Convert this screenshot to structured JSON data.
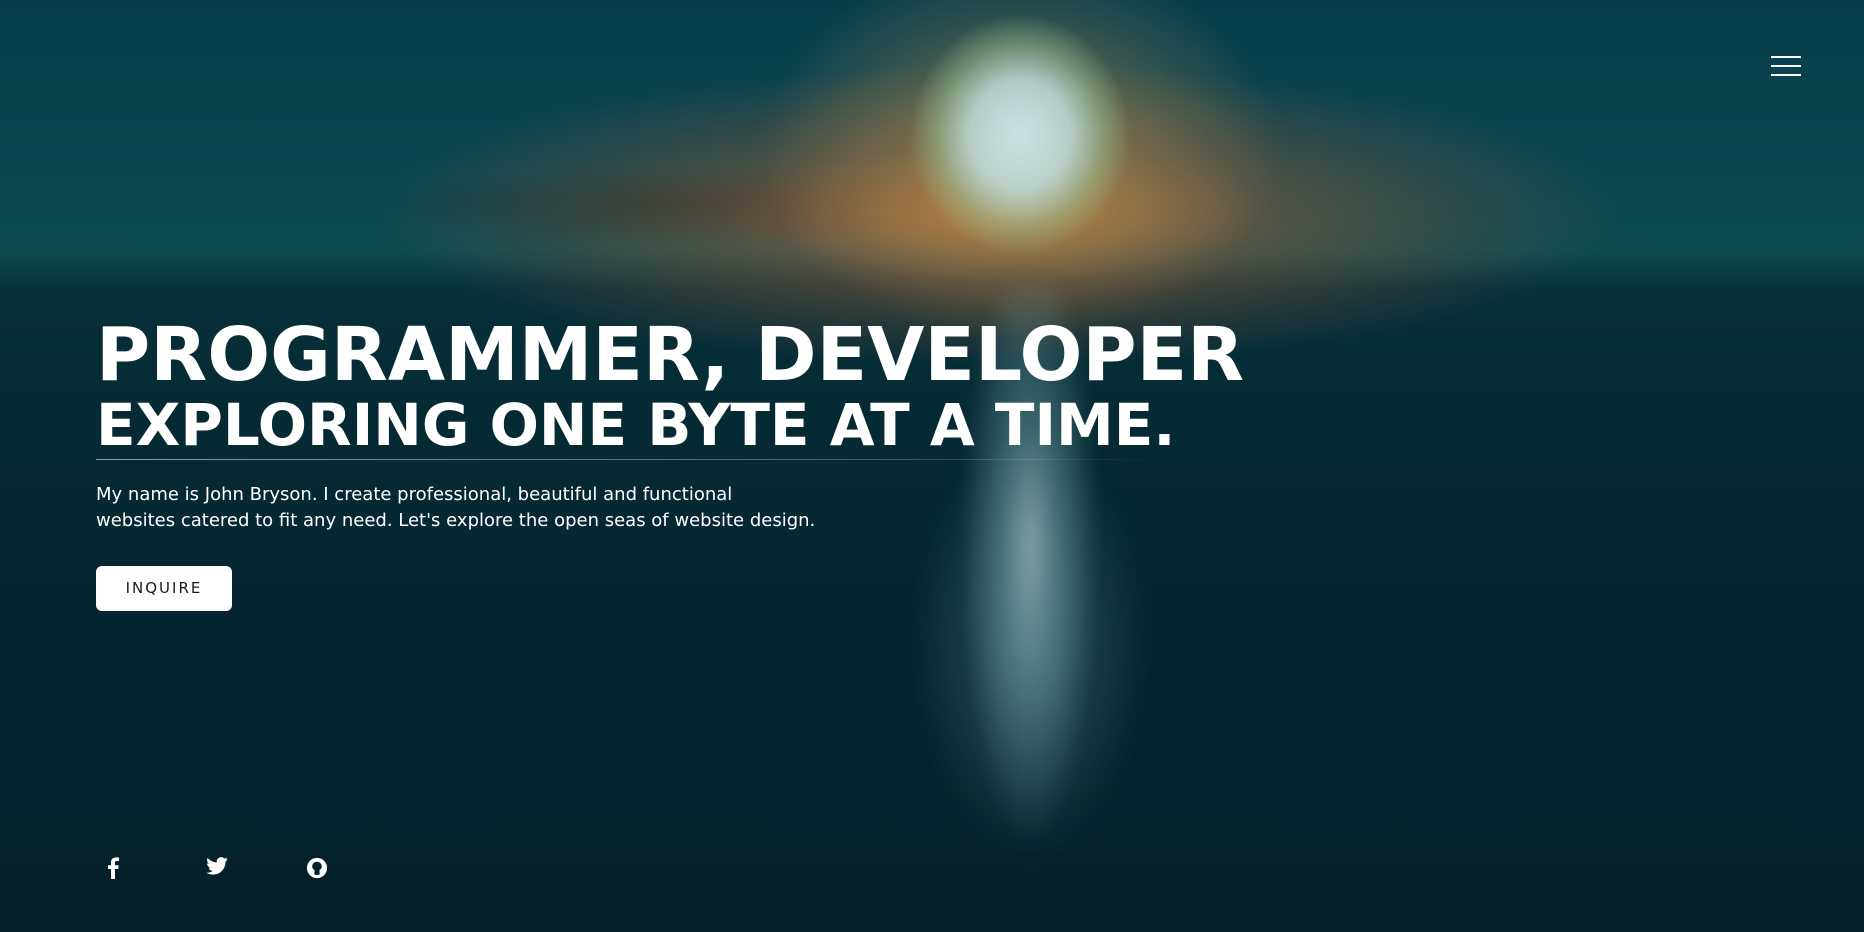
{
  "nav": {
    "menu_icon": "hamburger-menu-icon"
  },
  "hero": {
    "headline": "PROGRAMMER, DEVELOPER",
    "subheadline": "EXPLORING ONE BYTE AT A TIME.",
    "intro_line1": "My name is John Bryson. I create professional, beautiful and functional",
    "intro_line2": "websites catered to fit any need. Let's explore the open seas of website design.",
    "cta_label": "INQUIRE"
  },
  "social": {
    "icons": [
      "facebook-icon",
      "twitter-icon",
      "github-icon"
    ]
  },
  "colors": {
    "text": "#ffffff",
    "button_bg": "#ffffff",
    "button_text": "#1a1a1a",
    "background_dark": "#05232c"
  }
}
